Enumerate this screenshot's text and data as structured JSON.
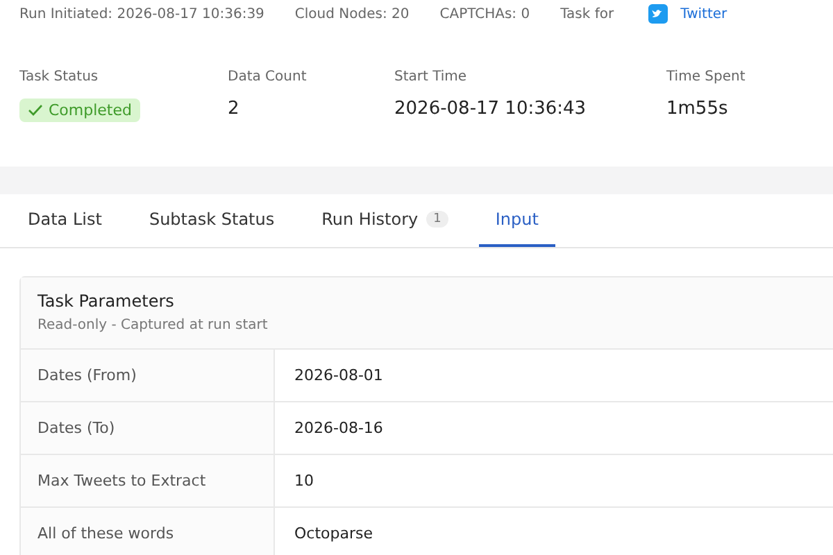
{
  "run_info": [
    {
      "label": "Run Initiated: 2026-08-17 10:36:39"
    },
    {
      "label": "Cloud Nodes: 20"
    },
    {
      "label": "CAPTCHAs: 0"
    },
    {
      "label": "Task for"
    }
  ],
  "task_link": "Twitter",
  "stats": [
    {
      "kind": "status",
      "label": "Task Status",
      "value": "Completed"
    },
    {
      "kind": "text",
      "label": "Data Count",
      "value": "2"
    },
    {
      "kind": "text",
      "label": "Start Time",
      "value": "2026-08-17 10:36:43"
    },
    {
      "kind": "text",
      "label": "Time Spent",
      "value": "1m55s"
    }
  ],
  "tabs": [
    {
      "label": "Data List",
      "selected": false
    },
    {
      "label": "Subtask Status",
      "selected": false
    },
    {
      "label": "Run History",
      "badge": "1",
      "selected": false
    },
    {
      "label": "Input",
      "selected": true
    }
  ],
  "panel": {
    "title": "Task Parameters",
    "subtitle": "Read-only - Captured at run start",
    "rows": [
      {
        "name": "Dates (From)",
        "value": "2026-08-01"
      },
      {
        "name": "Dates (To)",
        "value": "2026-08-16"
      },
      {
        "name": "Max Tweets to Extract",
        "value": "10"
      },
      {
        "name": "All of these words",
        "value": "Octoparse"
      }
    ]
  }
}
